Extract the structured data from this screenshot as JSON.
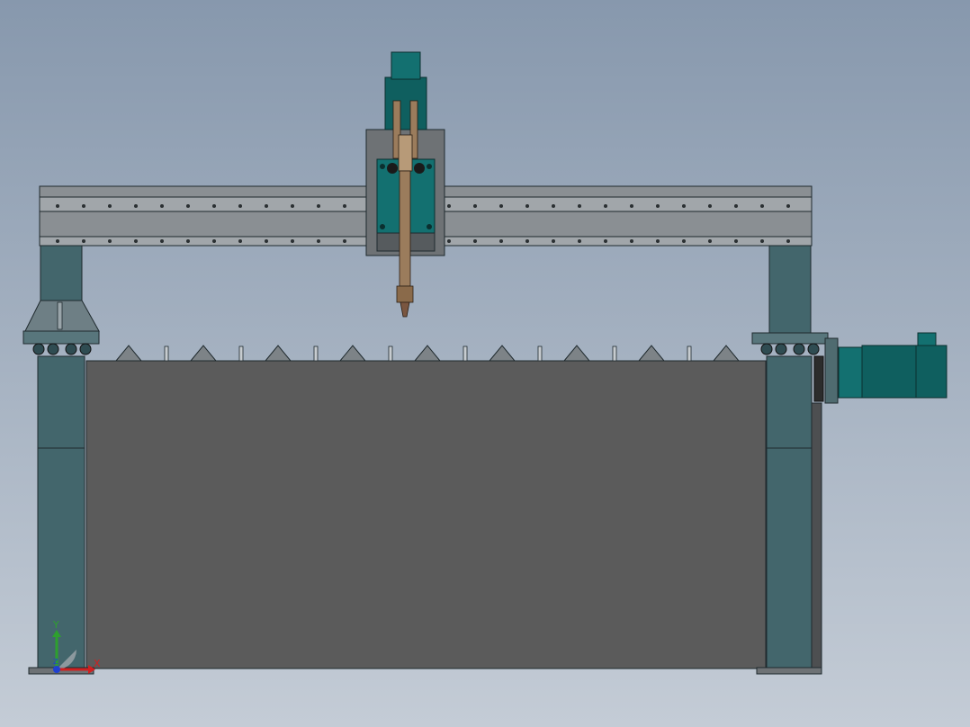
{
  "view": {
    "background_top": "#8798ad",
    "background_bottom": "#c4ccd6"
  },
  "colors": {
    "frame_teal": "#43666c",
    "frame_teal_dark": "#2f4c52",
    "rail_gray": "#8a8f93",
    "rail_gray_light": "#a1a6aa",
    "bed_gray": "#5b5b5b",
    "edge": "#1f2a2e",
    "carriage_gray": "#6e7275",
    "motor_teal": "#0f5f5f",
    "torch_brown": "#9b7c5c"
  },
  "triad": {
    "y_label": "Y",
    "x_label": "X",
    "z_label": "Z",
    "y_color": "#2ea02e",
    "x_color": "#d02020",
    "z_color": "#2040d0"
  }
}
